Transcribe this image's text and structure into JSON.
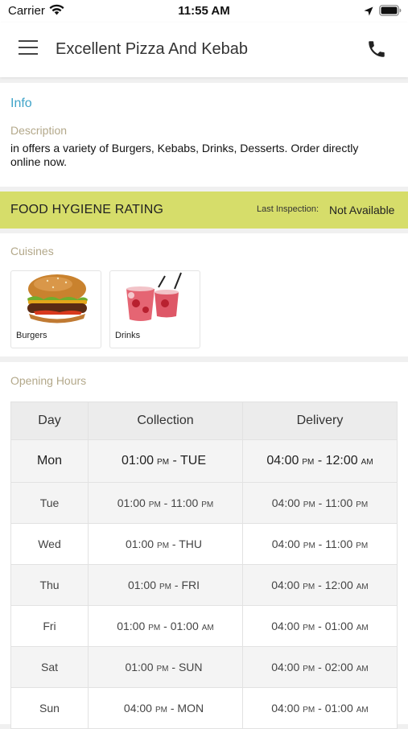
{
  "status_bar": {
    "carrier": "Carrier",
    "time": "11:55 AM"
  },
  "app_bar": {
    "title": "Excellent Pizza And Kebab"
  },
  "info": {
    "heading": "Info",
    "description_label": "Description",
    "description": "in  offers a variety of Burgers, Kebabs, Drinks, Desserts. Order directly online now."
  },
  "hygiene": {
    "title": "FOOD HYGIENE RATING",
    "last_inspection_label": "Last Inspection:",
    "last_inspection_value": "Not Available",
    "bar_color": "#d6dd6a"
  },
  "cuisines": {
    "heading": "Cuisines",
    "items": [
      {
        "label": "Burgers",
        "icon": "burger-image"
      },
      {
        "label": "Drinks",
        "icon": "drinks-image"
      }
    ]
  },
  "opening_hours": {
    "heading": "Opening Hours",
    "columns": [
      "Day",
      "Collection",
      "Delivery"
    ],
    "rows": [
      {
        "day": "Mon",
        "collection": {
          "t1": "01:00",
          "m1": "PM",
          "t2": "TUE",
          "m2": ""
        },
        "delivery": {
          "t1": "04:00",
          "m1": "PM",
          "t2": "12:00",
          "m2": "AM"
        }
      },
      {
        "day": "Tue",
        "collection": {
          "t1": "01:00",
          "m1": "PM",
          "t2": "11:00",
          "m2": "PM"
        },
        "delivery": {
          "t1": "04:00",
          "m1": "PM",
          "t2": "11:00",
          "m2": "PM"
        }
      },
      {
        "day": "Wed",
        "collection": {
          "t1": "01:00",
          "m1": "PM",
          "t2": "THU",
          "m2": ""
        },
        "delivery": {
          "t1": "04:00",
          "m1": "PM",
          "t2": "11:00",
          "m2": "PM"
        }
      },
      {
        "day": "Thu",
        "collection": {
          "t1": "01:00",
          "m1": "PM",
          "t2": "FRI",
          "m2": ""
        },
        "delivery": {
          "t1": "04:00",
          "m1": "PM",
          "t2": "12:00",
          "m2": "AM"
        }
      },
      {
        "day": "Fri",
        "collection": {
          "t1": "01:00",
          "m1": "PM",
          "t2": "01:00",
          "m2": "AM"
        },
        "delivery": {
          "t1": "04:00",
          "m1": "PM",
          "t2": "01:00",
          "m2": "AM"
        }
      },
      {
        "day": "Sat",
        "collection": {
          "t1": "01:00",
          "m1": "PM",
          "t2": "SUN",
          "m2": ""
        },
        "delivery": {
          "t1": "04:00",
          "m1": "PM",
          "t2": "02:00",
          "m2": "AM"
        }
      },
      {
        "day": "Sun",
        "collection": {
          "t1": "04:00",
          "m1": "PM",
          "t2": "MON",
          "m2": ""
        },
        "delivery": {
          "t1": "04:00",
          "m1": "PM",
          "t2": "01:00",
          "m2": "AM"
        }
      }
    ]
  }
}
